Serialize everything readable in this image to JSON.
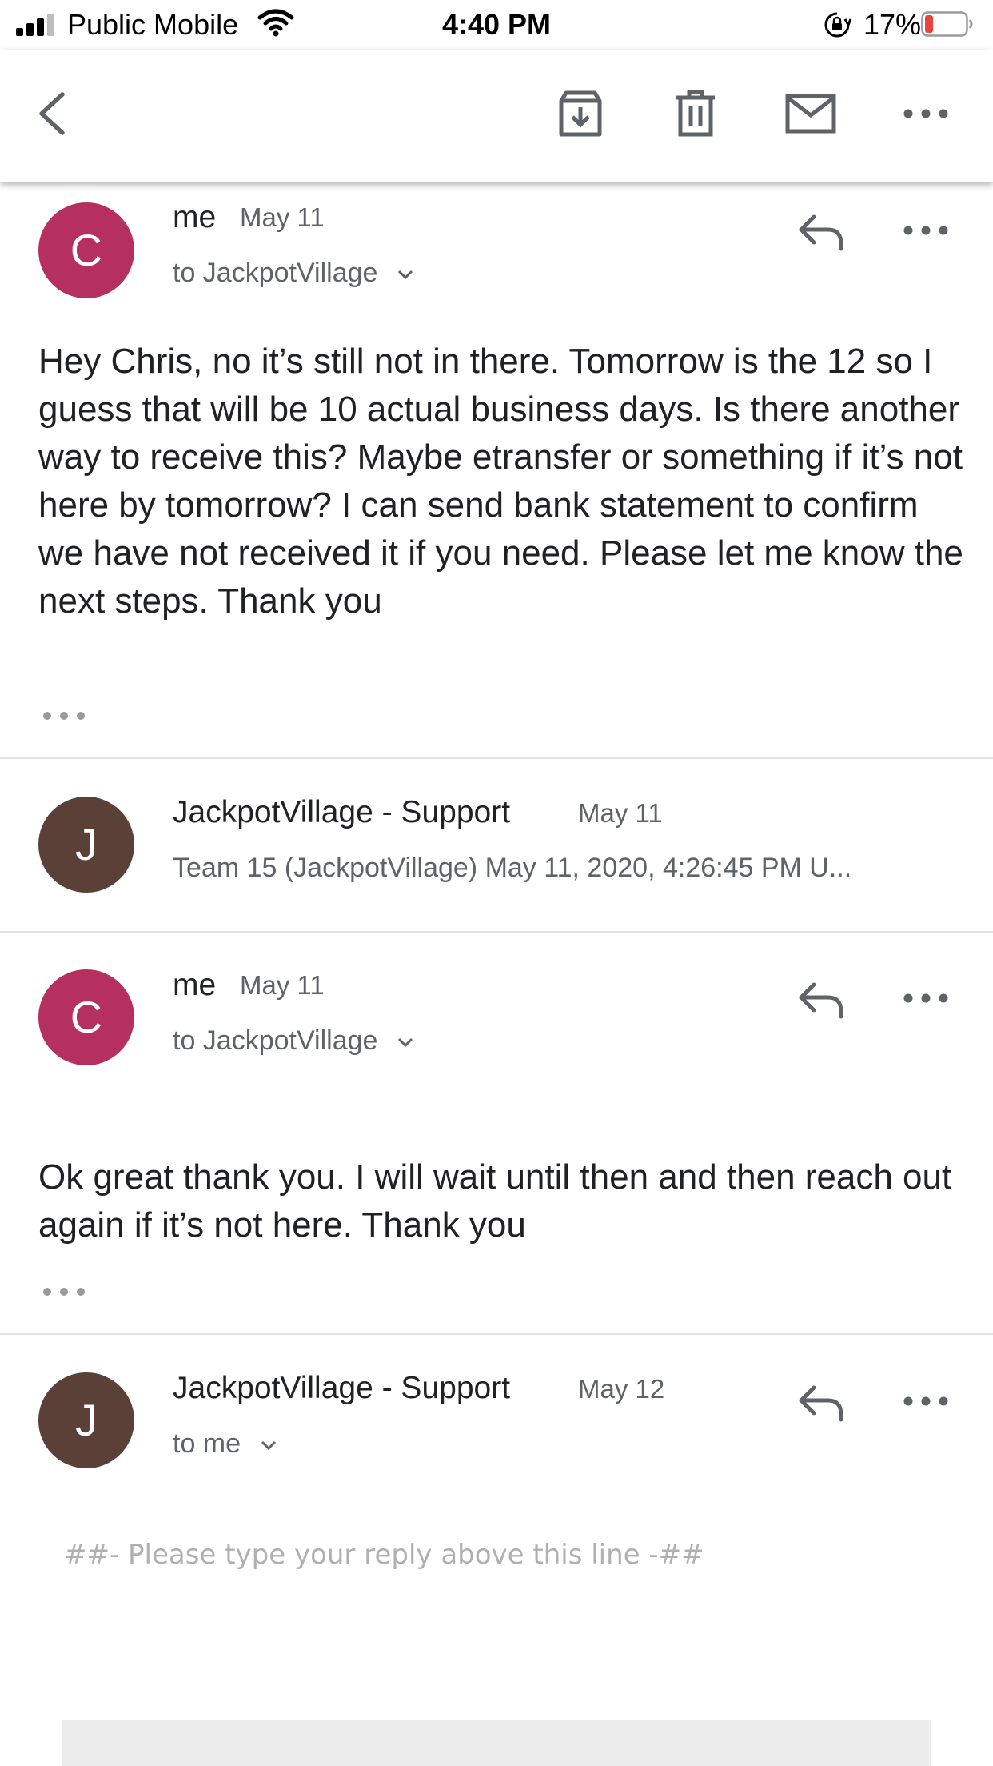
{
  "status_bar": {
    "carrier": "Public Mobile",
    "time": "4:40 PM",
    "battery_percent": "17%",
    "battery_level": 0.17,
    "icons": [
      "signal-icon",
      "wifi-icon",
      "rotation-lock-icon",
      "battery-icon"
    ]
  },
  "toolbar": {
    "icons": [
      "back-arrow-icon",
      "archive-icon",
      "trash-icon",
      "mark-unread-icon",
      "more-icon"
    ]
  },
  "messages": [
    {
      "avatar": "C",
      "sender": "me",
      "date": "May 11",
      "recipient": "to JackpotVillage",
      "body": "Hey Chris, no it’s still not in there. Tomorrow is the 12 so I guess that will be 10 actual business days. Is there another way to receive this? Maybe etransfer or something if it’s not here by tomorrow? I can send bank statement to confirm we have not received it if you need. Please let me know the next steps. Thank you"
    },
    {
      "avatar": "J",
      "sender": "JackpotVillage - Support",
      "date": "May 11",
      "preview": "Team 15 (JackpotVillage) May 11, 2020, 4:26:45 PM U..."
    },
    {
      "avatar": "C",
      "sender": "me",
      "date": "May 11",
      "recipient": "to JackpotVillage",
      "body": "Ok great thank you. I will wait until then and then reach out again if it’s not here. Thank you"
    },
    {
      "avatar": "J",
      "sender": "JackpotVillage - Support",
      "date": "May 12",
      "recipient": "to me",
      "reply_line": "##- Please type your reply above this line -##"
    }
  ],
  "colors": {
    "avatar_me": "#b5305e",
    "avatar_support": "#5a4036",
    "battery_low": "#e8453c"
  }
}
